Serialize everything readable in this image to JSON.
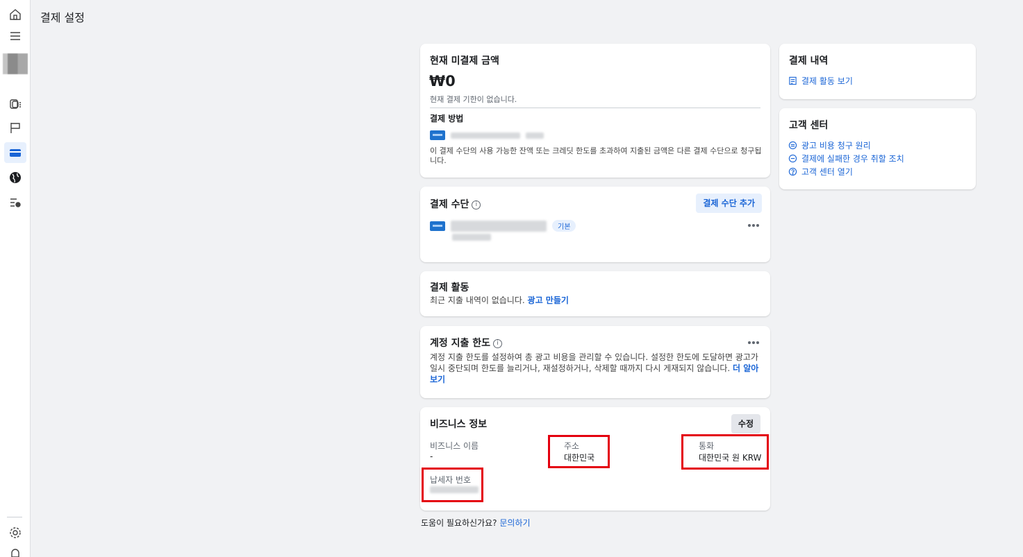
{
  "page": {
    "title": "결제 설정"
  },
  "sidebar": {
    "items": [
      {
        "icon": "home-icon"
      },
      {
        "icon": "menu-icon"
      },
      {
        "icon": "pages-icon"
      },
      {
        "icon": "flag-icon"
      },
      {
        "icon": "credit-card-icon"
      },
      {
        "icon": "globe-icon"
      },
      {
        "icon": "list-settings-icon"
      },
      {
        "icon": "gear-icon"
      },
      {
        "icon": "bell-icon"
      }
    ]
  },
  "balance_card": {
    "title": "현재 미결제 금액",
    "amount": "₩0",
    "due_text": "현재 결제 기한이 없습니다.",
    "method_title": "결제 방법",
    "note": "이 결제 수단의 사용 가능한 잔액 또는 크레딧 한도를 초과하여 지출된 금액은 다른 결제 수단으로 청구됩니다."
  },
  "payment_methods_card": {
    "title": "결제 수단",
    "add_button": "결제 수단 추가",
    "default_badge": "기본"
  },
  "activity_card": {
    "title": "결제 활동",
    "text": "최근 지출 내역이 없습니다.",
    "link": "광고 만들기"
  },
  "spending_limit_card": {
    "title": "계정 지출 한도",
    "description": "계정 지출 한도를 설정하여 총 광고 비용을 관리할 수 있습니다. 설정한 한도에 도달하면 광고가 일시 중단되며 한도를 늘리거나, 재설정하거나, 삭제할 때까지 다시 게재되지 않습니다.",
    "link": "더 알아보기"
  },
  "business_card": {
    "title": "비즈니스 정보",
    "edit_button": "수정",
    "name_label": "비즈니스 이름",
    "name_value": "-",
    "address_label": "주소",
    "address_value": "대한민국",
    "currency_label": "통화",
    "currency_value": "대한민국 원 KRW",
    "tax_label": "납세자 번호"
  },
  "help": {
    "text": "도움이 필요하신가요?",
    "link": "문의하기"
  },
  "billing_history_card": {
    "title": "결제 내역",
    "link": "결제 활동 보기"
  },
  "help_center_card": {
    "title": "고객 센터",
    "links": [
      "광고 비용 청구 원리",
      "결제에 실패한 경우 취할 조치",
      "고객 센터 열기"
    ]
  },
  "colors": {
    "accent": "#1a65d6",
    "highlight_box": "#e4000f"
  }
}
